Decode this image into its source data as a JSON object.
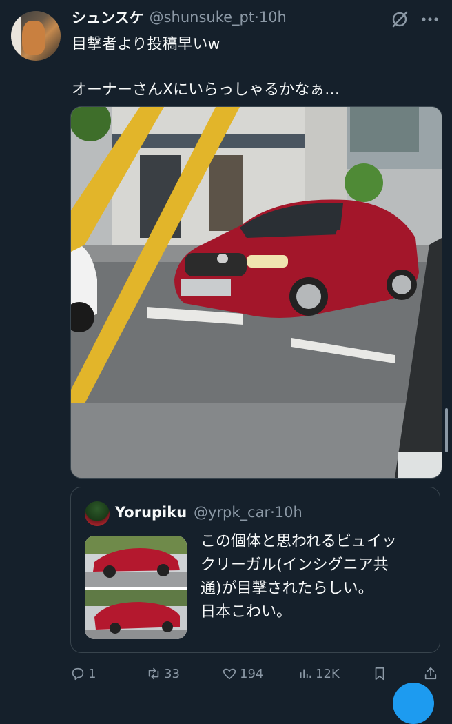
{
  "tweet": {
    "display_name": "シュンスケ",
    "handle": "@shunsuke_pt",
    "separator": "·",
    "time": "10h",
    "text_line1": "目撃者より投稿早いw",
    "text_line2": "オーナーさんXにいらっしゃるかなぁ…"
  },
  "quote": {
    "display_name": "Yorupiku",
    "handle": "@yrpk_car",
    "separator": "·",
    "time": "10h",
    "text_lines": [
      "この個体と思われるビュイッ",
      "クリーガル(インシグニア共",
      "通)が目撃されたらしい。",
      "日本こわい。"
    ]
  },
  "actions": {
    "reply_count": "1",
    "retweet_count": "33",
    "like_count": "194",
    "view_count": "12K"
  },
  "colors": {
    "background": "#15202b",
    "secondary_text": "#8b98a5",
    "border": "#38444d",
    "accent": "#1d9bf0",
    "car_red": "#a3162a",
    "pole_yellow": "#e2b52a"
  },
  "icons": [
    "grok-icon",
    "more-icon",
    "reply-icon",
    "retweet-icon",
    "like-icon",
    "views-icon",
    "bookmark-icon",
    "share-icon"
  ]
}
